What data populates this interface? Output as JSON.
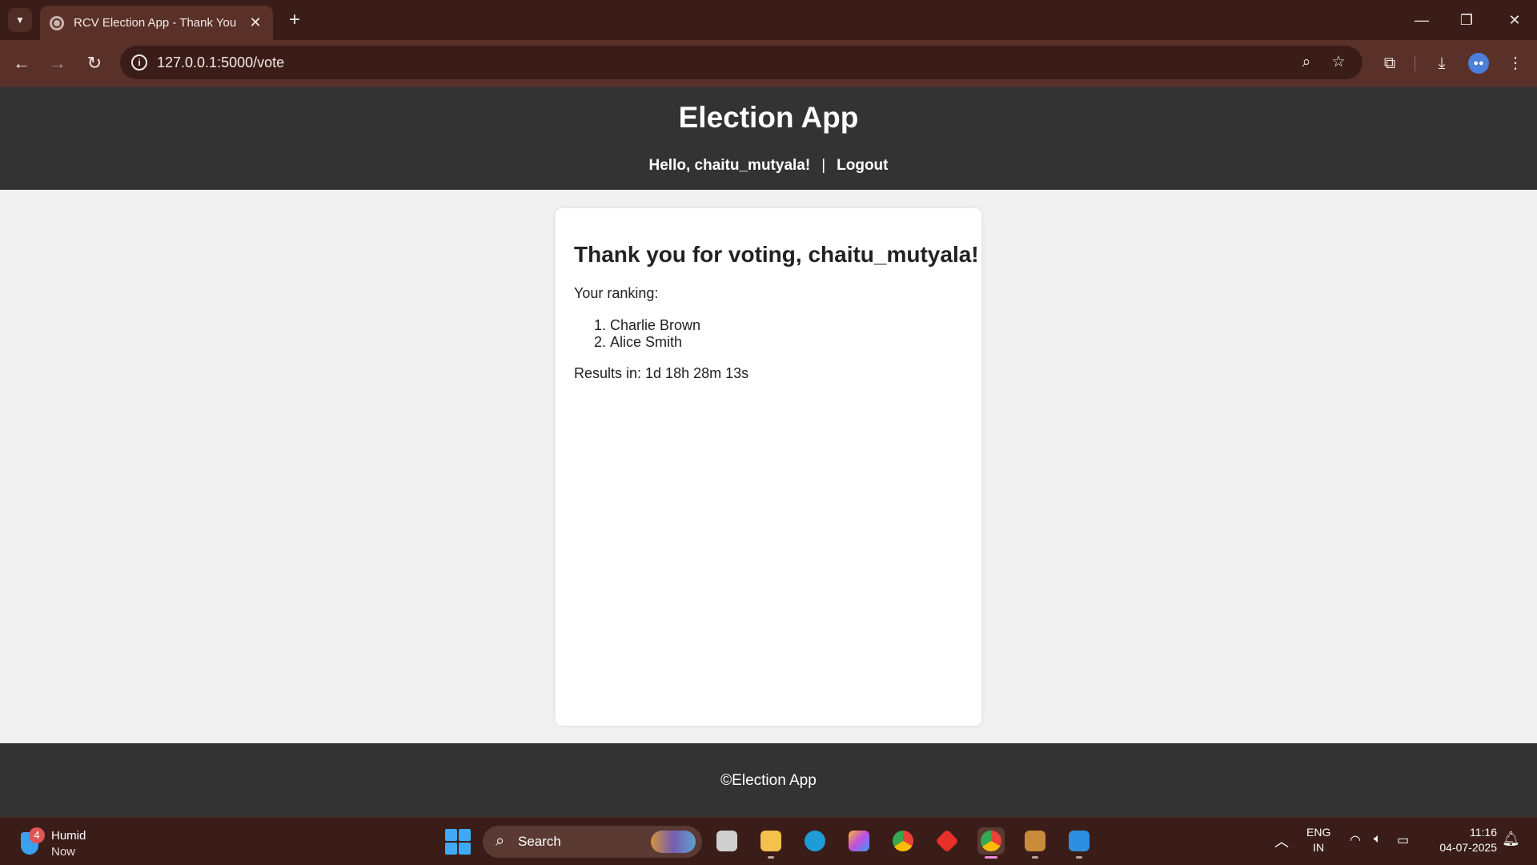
{
  "browser": {
    "tab_title": "RCV Election App - Thank You",
    "url": "127.0.0.1:5000/vote"
  },
  "header": {
    "title": "Election App",
    "greeting": "Hello, chaitu_mutyala!",
    "separator": "|",
    "logout_label": "Logout"
  },
  "confirmation": {
    "heading": "Thank you for voting, chaitu_mutyala!",
    "ranking_label": "Your ranking:",
    "ranking": [
      "Charlie Brown",
      "Alice Smith"
    ],
    "results_countdown": "Results in: 1d 18h 28m 13s"
  },
  "footer": {
    "text": "©Election App"
  },
  "taskbar": {
    "weather_title": "Humid",
    "weather_subtitle": "Now",
    "weather_badge": "4",
    "search_label": "Search",
    "language_line1": "ENG",
    "language_line2": "IN",
    "time": "11:16",
    "date": "04-07-2025"
  },
  "colors": {
    "header_bg": "#333333",
    "page_bg": "#f1f1f1",
    "card_bg": "#ffffff",
    "browser_frame": "#3a1d18",
    "browser_toolbar": "#5a3129"
  }
}
